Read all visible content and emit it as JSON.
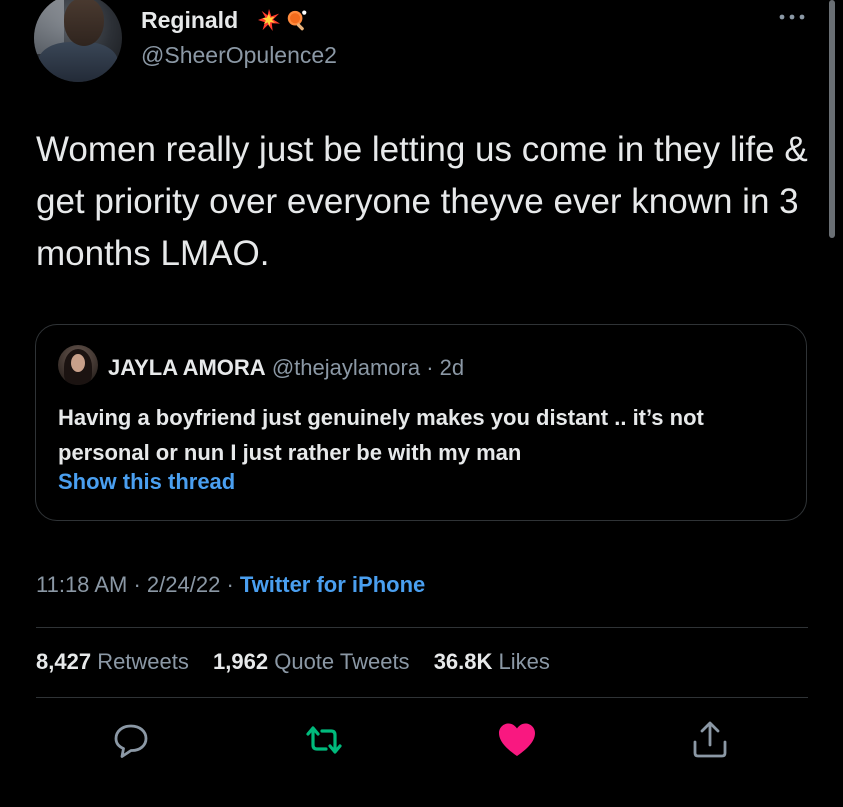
{
  "author": {
    "display_name": "Reginald",
    "handle": "@SheerOpulence2",
    "emojis": [
      "collision-emoji",
      "ping-pong-emoji"
    ]
  },
  "tweet": {
    "text": "Women really just be letting us come in they life & get priority over everyone theyve ever known in 3 months LMAO."
  },
  "quote": {
    "name": "JAYLA AMORA",
    "handle": "@thejaylamora",
    "age": "· 2d",
    "text": "Having a boyfriend just genuinely makes you distant .. it’s not personal or nun I just rather be with my man",
    "show_thread": "Show this thread"
  },
  "meta": {
    "time": "11:18 AM",
    "sep1": "·",
    "date": "2/24/22",
    "sep2": "·",
    "source": "Twitter for iPhone"
  },
  "stats": {
    "retweets_count": "8,427",
    "retweets_label": "Retweets",
    "quotes_count": "1,962",
    "quotes_label": "Quote Tweets",
    "likes_count": "36.8K",
    "likes_label": "Likes"
  },
  "actions": {
    "reply_icon": "reply-icon",
    "retweet_icon": "retweet-icon",
    "like_icon": "heart-icon",
    "share_icon": "share-icon"
  },
  "colors": {
    "background": "#000000",
    "text_primary": "#e7e9ea",
    "text_secondary": "#8b98a5",
    "link": "#4a9ff0",
    "retweet_green": "#00ba7c",
    "like_pink": "#f91880",
    "border": "#2f3336"
  }
}
